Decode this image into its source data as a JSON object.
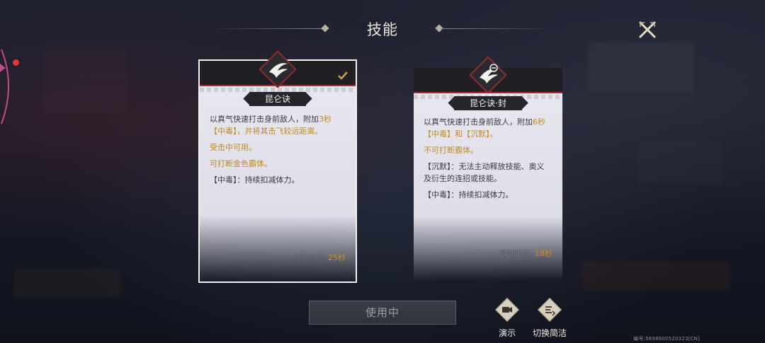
{
  "header": {
    "title": "技能"
  },
  "cards": [
    {
      "name": "昆仑诀",
      "selected": true,
      "lines": [
        {
          "text": "以真气快速打击身前敌人，附加",
          "highlight": "3秒",
          "tail": ""
        },
        {
          "text": "【中毒】，并将其击飞较远距离。"
        },
        {
          "text": "受击中可用。"
        },
        {
          "text": "可打断金色霸体。"
        },
        {
          "text": "【中毒】：持续扣减体力。"
        }
      ],
      "cooldown_label": "冷却时间: ",
      "cooldown_value": "25秒"
    },
    {
      "name": "昆仑诀·封",
      "selected": false,
      "lines": [
        {
          "text": "以真气快速打击身前敌人，附加",
          "highlight": "6秒",
          "tail": ""
        },
        {
          "text": "【中毒】和【沉默】。"
        },
        {
          "text": "不可打断霸体。"
        },
        {
          "text": "【沉默】：无法主动释放技能、奥义"
        },
        {
          "text": "及衍生的连招或技能。"
        },
        {
          "text": "【中毒】：持续扣减体力。"
        }
      ],
      "cooldown_label": "冷却时间: ",
      "cooldown_value": "18秒"
    }
  ],
  "footer": {
    "use_button": "使用中",
    "demo_label": "演示",
    "switch_label": "切换简洁",
    "build_id": "编号:5698600520323[CN]"
  },
  "colors": {
    "gold_text": "#c08a22",
    "cooldown_value": "#d38a1b",
    "card_bg": "#e9e9f1",
    "accent_red": "#a83034"
  },
  "icons": [
    "close-icon",
    "skill-icon",
    "check-icon",
    "video-icon",
    "list-icon"
  ]
}
